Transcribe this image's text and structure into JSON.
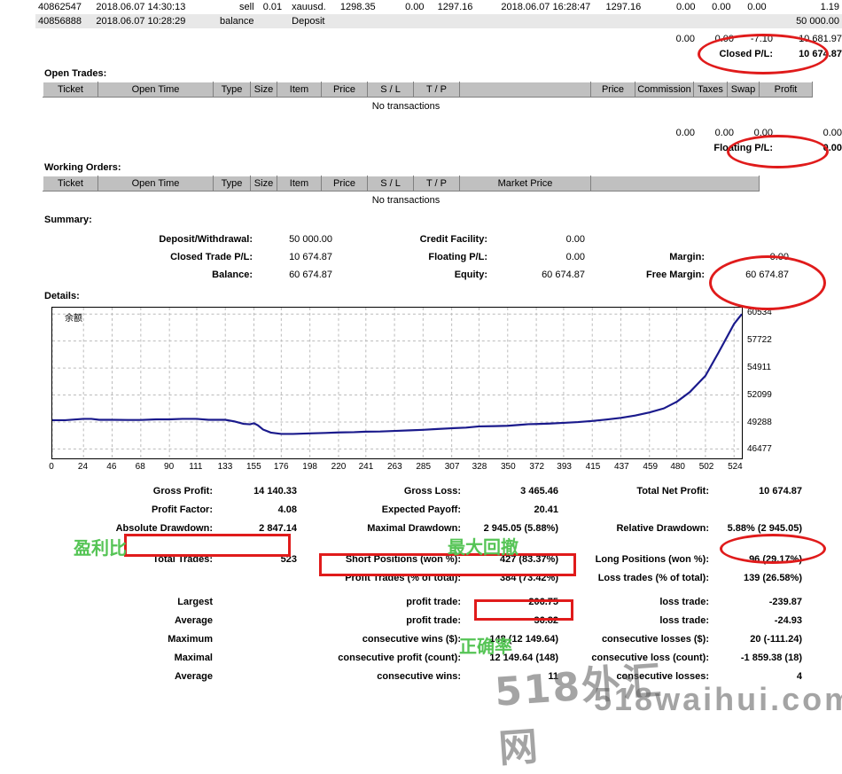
{
  "transactions": {
    "rows": [
      {
        "ticket": "40862547",
        "open_time": "2018.06.07 14:30:13",
        "type": "sell",
        "size": "0.01",
        "item": "xauusd.",
        "price": "1298.35",
        "sl": "0.00",
        "tp": "1297.16",
        "close_time": "2018.06.07 16:28:47",
        "close_price": "1297.16",
        "commission": "0.00",
        "taxes": "0.00",
        "swap": "0.00",
        "profit": "1.19",
        "alt": false
      },
      {
        "ticket": "40856888",
        "open_time": "2018.06.07 10:28:29",
        "type": "balance",
        "size": "",
        "item": "Deposit",
        "price": "",
        "sl": "",
        "tp": "",
        "close_time": "",
        "close_price": "",
        "commission": "",
        "taxes": "",
        "swap": "",
        "profit": "50 000.00",
        "alt": true
      }
    ],
    "totals": {
      "commission": "0.00",
      "taxes": "0.00",
      "swap": "-7.10",
      "profit": "10 681.97",
      "closed_pl_label": "Closed P/L:",
      "closed_pl_value": "10 674.87"
    }
  },
  "open_trades": {
    "title": "Open Trades:",
    "headers": [
      "Ticket",
      "Open Time",
      "Type",
      "Size",
      "Item",
      "Price",
      "S / L",
      "T / P",
      "",
      "Price",
      "Commission",
      "Taxes",
      "Swap",
      "Profit"
    ],
    "empty_text": "No transactions",
    "totals": {
      "commission": "0.00",
      "taxes": "0.00",
      "swap": "0.00",
      "profit": "0.00",
      "floating_pl_label": "Floating P/L:",
      "floating_pl_value": "0.00"
    }
  },
  "working_orders": {
    "title": "Working Orders:",
    "headers": [
      "Ticket",
      "Open Time",
      "Type",
      "Size",
      "Item",
      "Price",
      "S / L",
      "T / P",
      "Market Price",
      ""
    ],
    "empty_text": "No transactions"
  },
  "summary": {
    "title": "Summary:",
    "rows": [
      {
        "l1": "Deposit/Withdrawal:",
        "v1": "50 000.00",
        "l2": "Credit Facility:",
        "v2": "0.00",
        "l3": "",
        "v3": ""
      },
      {
        "l1": "Closed Trade P/L:",
        "v1": "10 674.87",
        "l2": "Floating P/L:",
        "v2": "0.00",
        "l3": "Margin:",
        "v3": "0.00"
      },
      {
        "l1": "Balance:",
        "v1": "60 674.87",
        "l2": "Equity:",
        "v2": "60 674.87",
        "l3": "Free Margin:",
        "v3": "60 674.87"
      }
    ]
  },
  "details": {
    "title": "Details:"
  },
  "chart_data": {
    "type": "line",
    "title": "",
    "corner_label": "余额",
    "xlabel": "",
    "ylabel": "",
    "grid": true,
    "legend": "none",
    "line_color": "#1a1a8c",
    "x_ticks": [
      0,
      24,
      46,
      68,
      90,
      111,
      133,
      155,
      176,
      198,
      220,
      241,
      263,
      285,
      307,
      328,
      350,
      372,
      393,
      415,
      437,
      459,
      480,
      502,
      524
    ],
    "y_ticks": [
      46477,
      49288,
      52099,
      54911,
      57722,
      60534
    ],
    "ylim": [
      45500,
      61200
    ],
    "xlim": [
      0,
      530
    ],
    "x": [
      0,
      10,
      24,
      30,
      36,
      46,
      58,
      68,
      80,
      90,
      100,
      111,
      120,
      133,
      140,
      147,
      152,
      155,
      158,
      162,
      168,
      176,
      185,
      198,
      210,
      220,
      232,
      241,
      252,
      263,
      275,
      285,
      296,
      307,
      318,
      328,
      340,
      350,
      360,
      366,
      372,
      382,
      393,
      404,
      415,
      426,
      437,
      448,
      459,
      470,
      480,
      490,
      502,
      512,
      524,
      530
    ],
    "y": [
      49480,
      49480,
      49620,
      49620,
      49520,
      49520,
      49500,
      49500,
      49560,
      49560,
      49620,
      49620,
      49520,
      49520,
      49350,
      49100,
      49050,
      49160,
      48950,
      48500,
      48180,
      48050,
      48050,
      48100,
      48150,
      48200,
      48230,
      48280,
      48300,
      48360,
      48420,
      48480,
      48560,
      48640,
      48700,
      48830,
      48860,
      48900,
      49000,
      49060,
      49080,
      49120,
      49200,
      49280,
      49400,
      49540,
      49720,
      49960,
      50280,
      50700,
      51400,
      52400,
      54100,
      56500,
      59500,
      60534
    ]
  },
  "stats": {
    "rows": [
      {
        "l1": "Gross Profit:",
        "v1": "14 140.33",
        "l2": "Gross Loss:",
        "v2": "3 465.46",
        "l3": "Total Net Profit:",
        "v3": "10 674.87"
      },
      {
        "l1": "Profit Factor:",
        "v1": "4.08",
        "l2": "Expected Payoff:",
        "v2": "20.41",
        "l3": "",
        "v3": ""
      },
      {
        "l1": "Absolute Drawdown:",
        "v1": "2 847.14",
        "l2": "Maximal Drawdown:",
        "v2": "2 945.05 (5.88%)",
        "l3": "Relative Drawdown:",
        "v3": "5.88% (2 945.05)"
      },
      {
        "l1": "Total Trades:",
        "v1": "523",
        "l2": "Short Positions (won %):",
        "v2": "427 (83.37%)",
        "l3": "Long Positions (won %):",
        "v3": "96 (29.17%)"
      },
      {
        "l1": "",
        "v1": "",
        "l2": "Profit Trades (% of total):",
        "v2": "384 (73.42%)",
        "l3": "Loss trades (% of total):",
        "v3": "139 (26.58%)"
      },
      {
        "l1": "Largest",
        "v1": "",
        "l2": "profit trade:",
        "v2": "206.75",
        "l3": "loss trade:",
        "v3": "-239.87"
      },
      {
        "l1": "Average",
        "v1": "",
        "l2": "profit trade:",
        "v2": "36.82",
        "l3": "loss trade:",
        "v3": "-24.93"
      },
      {
        "l1": "Maximum",
        "v1": "",
        "l2": "consecutive wins ($):",
        "v2": "148 (12 149.64)",
        "l3": "consecutive losses ($):",
        "v3": "20 (-111.24)"
      },
      {
        "l1": "Maximal",
        "v1": "",
        "l2": "consecutive profit (count):",
        "v2": "12 149.64 (148)",
        "l3": "consecutive loss (count):",
        "v3": "-1 859.38 (18)"
      },
      {
        "l1": "Average",
        "v1": "",
        "l2": "consecutive wins:",
        "v2": "11",
        "l3": "consecutive losses:",
        "v3": "4"
      }
    ]
  },
  "annotations": {
    "cn_profit_ratio": "盈利比",
    "cn_max_drawdown": "最大回撤",
    "cn_accuracy": "正确率",
    "color": "#55c455",
    "highlight_color": "#e01b1b"
  },
  "watermark": {
    "cn": "518外汇网",
    "en": "518waihui.com"
  }
}
